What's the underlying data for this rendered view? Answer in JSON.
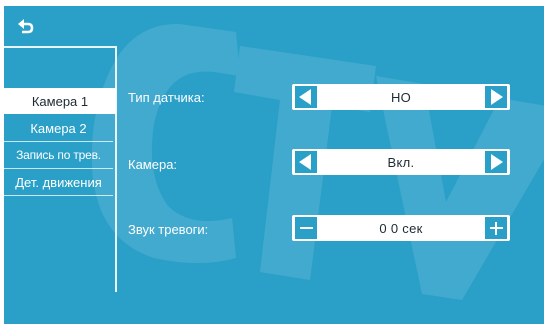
{
  "header": {
    "back_icon": "return-arrow-icon"
  },
  "sidebar": {
    "items": [
      {
        "label": "Камера 1",
        "active": true
      },
      {
        "label": "Камера 2",
        "active": false
      },
      {
        "label": "Запись по трев.",
        "active": false
      },
      {
        "label": "Дет. движения",
        "active": false
      }
    ]
  },
  "settings": {
    "sensor_type": {
      "label": "Тип датчика:",
      "value": "НО"
    },
    "camera": {
      "label": "Камера:",
      "value": "Вкл."
    },
    "alarm_sound": {
      "label": "Звук тревоги:",
      "value": "0 0 сек"
    }
  },
  "watermark_text": "CTV",
  "colors": {
    "background": "#2aa0c8",
    "active_tab": "#ffffff",
    "text": "#ffffff"
  }
}
